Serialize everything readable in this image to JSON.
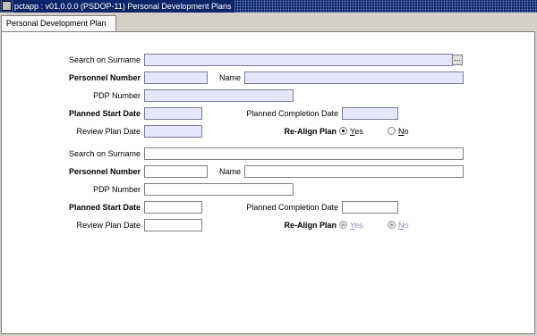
{
  "window": {
    "title": "pctapp : v01.0.0.0 (PSDOP-11) Personal Development Plans"
  },
  "tab": {
    "label": "Personal Development Plan"
  },
  "labels": {
    "search_surname": "Search on Surname",
    "personnel_number": "Personnel Number",
    "name": "Name",
    "pdp_number": "PDP Number",
    "planned_start": "Planned Start Date",
    "planned_completion": "Planned Completion Date",
    "review_plan": "Review Plan Date",
    "realign_plan": "Re-Align Plan"
  },
  "radio": {
    "yes_first": "Y",
    "yes_rest": "es",
    "no_first": "N",
    "no_rest": "o"
  },
  "form1": {
    "search_surname": "",
    "personnel_number": "",
    "name": "",
    "pdp_number": "",
    "planned_start": "",
    "planned_completion": "",
    "review_plan": "",
    "realign_selected": "Yes",
    "enabled": true
  },
  "form2": {
    "search_surname": "",
    "personnel_number": "",
    "name": "",
    "pdp_number": "",
    "planned_start": "",
    "planned_completion": "",
    "review_plan": "",
    "realign_selected": "Yes",
    "enabled": false
  },
  "colors": {
    "titlebar": "#0a246a",
    "highlight_field": "#e6e6fa",
    "disabled_text": "#9090b8"
  },
  "icons": {
    "app": "app-icon",
    "lookup": "lookup-dots-icon"
  }
}
